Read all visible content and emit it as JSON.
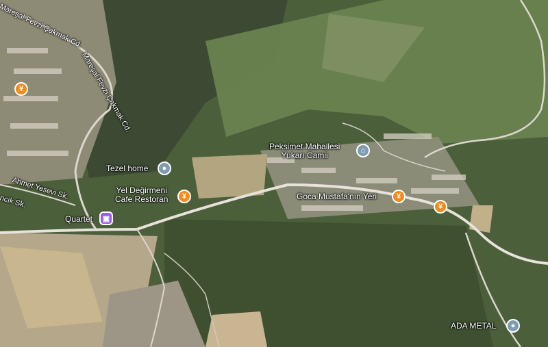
{
  "map": {
    "type": "satellite",
    "colors": {
      "vegetation": "#4f6b3a",
      "dry_land": "#b8a886",
      "road": "#e7e2da",
      "food_pin": "#f28b1c",
      "place_pin": "#7f9bb0",
      "shop_pin": "#9b5de5"
    }
  },
  "roads": {
    "marsal_fevzi_1": "Mareşal Fevzi Çakmak Cd.",
    "marsal_fevzi_2": "Mareşal Fevzi Çakmak Cd.",
    "ahmet_yesevi": "Ahmet Yesevi Sk.",
    "cik_sk": "ncık Sk."
  },
  "places": {
    "peksimet_line1": "Peksimet Mahallesi",
    "peksimet_line2": "Yukarı Camii",
    "tezel": "Tezel home",
    "yel_line1": "Yel Değirmeni",
    "yel_line2": "Cafe Restoran",
    "goca": "Goca Mustafa'nın Yeri",
    "quartet": "Quartet",
    "ada": "ADA METAL"
  },
  "icons": {
    "restaurant": "fork-knife-icon",
    "mosque": "mosque-icon",
    "pin": "place-pin-icon",
    "shop": "shopping-bag-icon"
  }
}
